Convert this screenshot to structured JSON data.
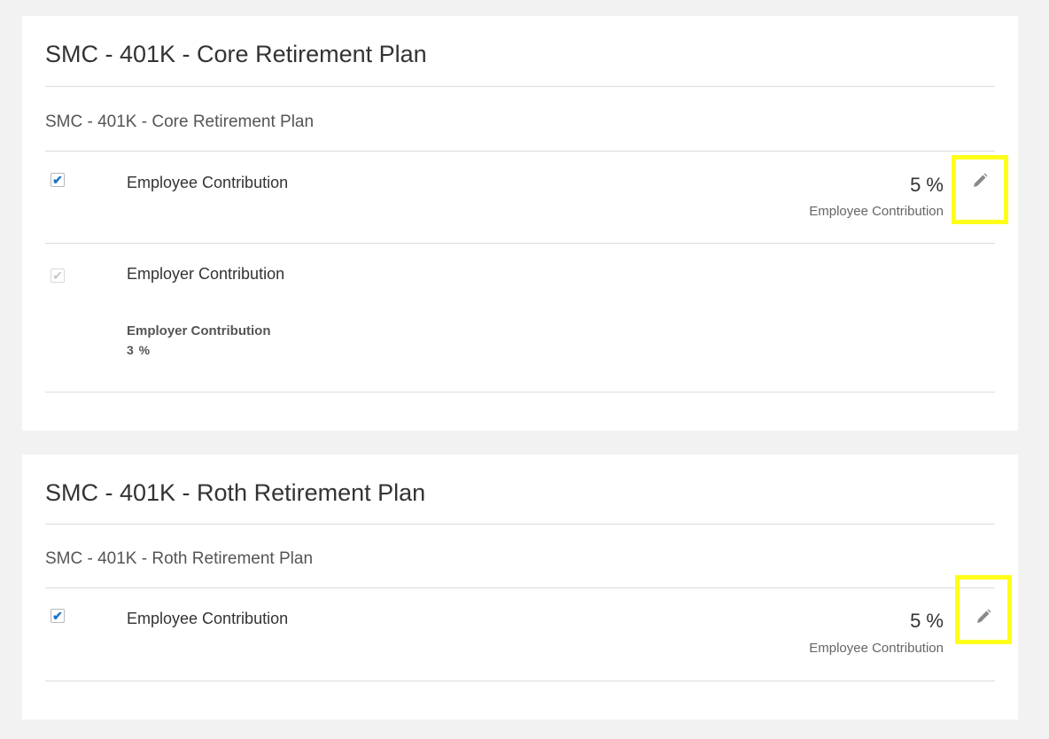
{
  "plans": [
    {
      "title": "SMC - 401K - Core Retirement Plan",
      "subtitle": "SMC - 401K - Core Retirement Plan",
      "employee_contribution": {
        "label": "Employee Contribution",
        "checked": true,
        "amount": "5 %",
        "amount_caption": "Employee Contribution",
        "edit_icon": "pencil-icon"
      },
      "employer_contribution": {
        "label": "Employer Contribution",
        "checked": true,
        "disabled": true,
        "detail_label": "Employer Contribution",
        "detail_value": "3 %"
      }
    },
    {
      "title": "SMC - 401K - Roth Retirement Plan",
      "subtitle": "SMC - 401K - Roth Retirement Plan",
      "employee_contribution": {
        "label": "Employee Contribution",
        "checked": true,
        "amount": "5 %",
        "amount_caption": "Employee Contribution",
        "edit_icon": "pencil-icon"
      }
    }
  ],
  "colors": {
    "page_background": "#f2f2f2",
    "card_background": "#ffffff",
    "checkbox_accent": "#1a73c7",
    "highlight_box": "#ffff1a",
    "icon_gray": "#8a8a8a"
  }
}
